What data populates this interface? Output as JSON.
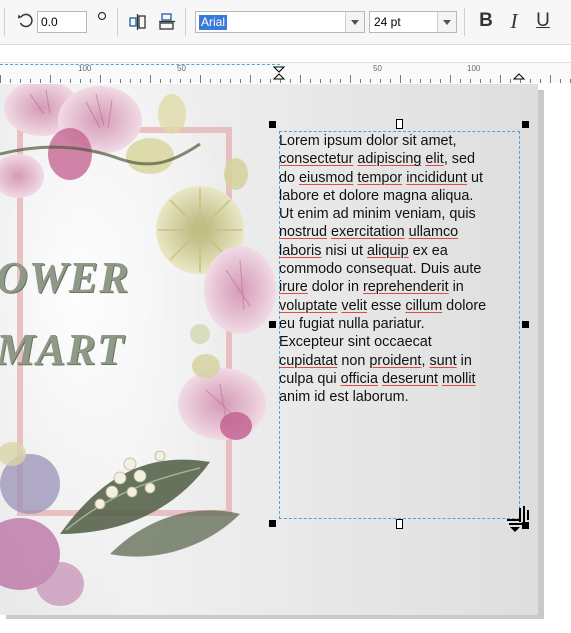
{
  "toolbar": {
    "rotation_value": "0.0",
    "font_name": "Arial",
    "font_size": "24 pt",
    "bold_label": "B",
    "italic_label": "I",
    "underline_label": "U",
    "icons": [
      "rotate-icon",
      "degree-icon",
      "horizontal-align-icon",
      "vertical-align-icon",
      "chevron-down-icon"
    ]
  },
  "ruler": {
    "labels": [
      "100",
      "50",
      "50",
      "100"
    ]
  },
  "artwork": {
    "title_line_1": "OWER",
    "title_line_2": "MART"
  },
  "text_frame": {
    "lines": [
      [
        {
          "t": "Lorem ipsum dolor sit amet,",
          "u": false
        }
      ],
      [
        {
          "t": "consectetur",
          "u": true
        },
        {
          "t": " ",
          "u": false
        },
        {
          "t": "adipiscing",
          "u": true
        },
        {
          "t": " ",
          "u": false
        },
        {
          "t": "elit",
          "u": true
        },
        {
          "t": ", sed",
          "u": false
        }
      ],
      [
        {
          "t": "do ",
          "u": false
        },
        {
          "t": "eiusmod",
          "u": true
        },
        {
          "t": " ",
          "u": false
        },
        {
          "t": "tempor",
          "u": true
        },
        {
          "t": " ",
          "u": false
        },
        {
          "t": "incididunt",
          "u": true
        },
        {
          "t": " ut",
          "u": false
        }
      ],
      [
        {
          "t": "labore et dolore magna aliqua.",
          "u": false
        }
      ],
      [
        {
          "t": "Ut enim ad minim veniam, quis",
          "u": false
        }
      ],
      [
        {
          "t": "nostrud",
          "u": true
        },
        {
          "t": " ",
          "u": false
        },
        {
          "t": "exercitation",
          "u": true
        },
        {
          "t": " ",
          "u": false
        },
        {
          "t": "ullamco",
          "u": true
        }
      ],
      [
        {
          "t": "laboris",
          "u": true
        },
        {
          "t": " nisi ut ",
          "u": false
        },
        {
          "t": "aliquip",
          "u": true
        },
        {
          "t": " ex ea",
          "u": false
        }
      ],
      [
        {
          "t": "commodo consequat. Duis aute",
          "u": false
        }
      ],
      [
        {
          "t": "irure",
          "u": true
        },
        {
          "t": " dolor in ",
          "u": false
        },
        {
          "t": "reprehenderit",
          "u": true
        },
        {
          "t": " in",
          "u": false
        }
      ],
      [
        {
          "t": "voluptate",
          "u": true
        },
        {
          "t": " ",
          "u": false
        },
        {
          "t": "velit",
          "u": true
        },
        {
          "t": " esse ",
          "u": false
        },
        {
          "t": "cillum",
          "u": true
        },
        {
          "t": " dolore",
          "u": false
        }
      ],
      [
        {
          "t": "eu fugiat nulla pariatur.",
          "u": false
        }
      ],
      [
        {
          "t": "Excepteur sint occaecat",
          "u": false
        }
      ],
      [
        {
          "t": "cupidatat",
          "u": true
        },
        {
          "t": " non ",
          "u": false
        },
        {
          "t": "proident",
          "u": true
        },
        {
          "t": ", ",
          "u": false
        },
        {
          "t": "sunt",
          "u": true
        },
        {
          "t": " in",
          "u": false
        }
      ],
      [
        {
          "t": "culpa qui ",
          "u": false
        },
        {
          "t": "officia",
          "u": true
        },
        {
          "t": " ",
          "u": false
        },
        {
          "t": "deserunt",
          "u": true
        },
        {
          "t": " ",
          "u": false
        },
        {
          "t": "mollit",
          "u": true
        }
      ],
      [
        {
          "t": "anim id est laborum.",
          "u": false
        }
      ]
    ]
  }
}
